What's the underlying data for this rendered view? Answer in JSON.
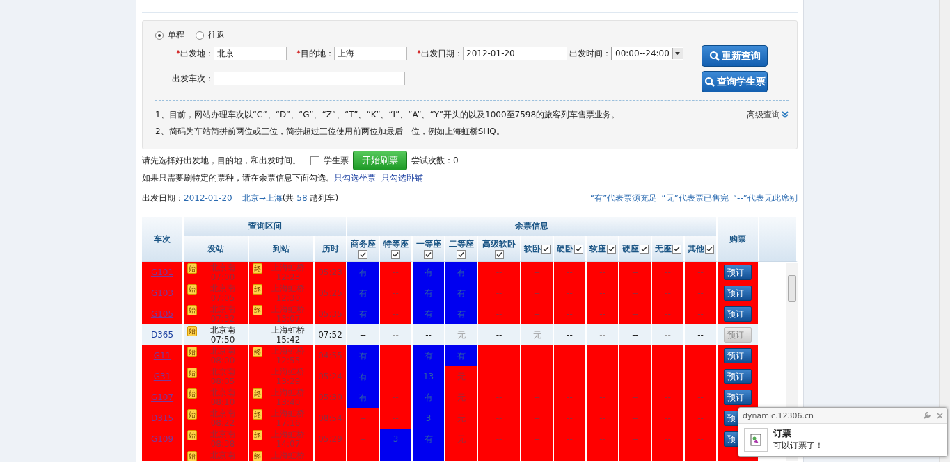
{
  "search": {
    "trip_types": [
      {
        "label": "单程",
        "selected": true
      },
      {
        "label": "往返",
        "selected": false
      }
    ],
    "from": {
      "mark": "*",
      "label": "出发地：",
      "value": "北京"
    },
    "to": {
      "mark": "*",
      "label": "目的地：",
      "value": "上海"
    },
    "date": {
      "mark": "*",
      "label": "出发日期：",
      "value": "2012-01-20"
    },
    "time": {
      "label": "出发时间：",
      "value": "00:00--24:00"
    },
    "train_no": {
      "label": "出发车次："
    },
    "buttons": [
      "重新查询",
      "查询学生票"
    ],
    "notes": [
      "1、目前，网站办理车次以“C”、“D”、“G”、“Z”、“T”、“K”、“L”、“A”、“Y”开头的以及1000至7598的旅客列车售票业务。",
      "2、简码为车站简拼前两位或三位，简拼超过三位使用前两位加最后一位，例如上海虹桥SHQ。"
    ],
    "advanced": "高级查询"
  },
  "refresh": {
    "hint": "请先选择好出发地，目的地，和出发时间。",
    "student": {
      "label": "学生票",
      "checked": false
    },
    "button": "开始刷票",
    "attempts": "尝试次数：0",
    "hint2": "如果只需要刷特定的票种，请在余票信息下面勾选。",
    "links": [
      "只勾选坐票",
      "只勾选卧铺"
    ]
  },
  "summary": {
    "date_label": "出发日期：",
    "date": "2012-01-20",
    "route": "北京→上海",
    "count_prefix": "(共",
    "count": "58",
    "count_suffix": "趟列车)",
    "legend": [
      "“有”代表票源充足",
      "“无”代表票已售完",
      "“--”代表无此席别"
    ]
  },
  "table": {
    "group_headers": [
      "车次",
      "查询区间",
      "余票信息",
      "购票"
    ],
    "route_headers": [
      "发站",
      "到站",
      "历时"
    ],
    "seat_headers": [
      {
        "label": "商务座",
        "checked": true
      },
      {
        "label": "特等座",
        "checked": true
      },
      {
        "label": "一等座",
        "checked": true
      },
      {
        "label": "二等座",
        "checked": true
      },
      {
        "label": "高级软卧",
        "checked": true
      },
      {
        "label": "软卧",
        "checked": true
      },
      {
        "label": "硬卧",
        "checked": true
      },
      {
        "label": "软座",
        "checked": true
      },
      {
        "label": "硬座",
        "checked": true
      },
      {
        "label": "无座",
        "checked": true
      },
      {
        "label": "其他",
        "checked": true
      }
    ],
    "rows": [
      {
        "train": "G101",
        "highlighted": true,
        "from_badge": "始",
        "from": "北京南",
        "dep": "07:00",
        "to_badge": "终",
        "to": "上海虹桥",
        "arr": "12:23",
        "duration": "05:23",
        "seats": [
          {
            "text": "有",
            "available": true
          },
          {
            "text": "--",
            "available": false
          },
          {
            "text": "有",
            "available": true
          },
          {
            "text": "有",
            "available": true
          },
          {
            "text": "--",
            "available": false
          },
          {
            "text": "--",
            "available": false
          },
          {
            "text": "--",
            "available": false
          },
          {
            "text": "--",
            "available": false
          },
          {
            "text": "--",
            "available": false
          },
          {
            "text": "--",
            "available": false
          },
          {
            "text": "--",
            "available": false
          }
        ],
        "button": {
          "label": "预订",
          "disabled": false
        }
      },
      {
        "train": "G103",
        "highlighted": true,
        "from_badge": "始",
        "from": "北京南",
        "dep": "07:05",
        "to_badge": "终",
        "to": "上海虹桥",
        "arr": "12:30",
        "duration": "05:25",
        "seats": [
          {
            "text": "有",
            "available": true
          },
          {
            "text": "--",
            "available": false
          },
          {
            "text": "有",
            "available": true
          },
          {
            "text": "有",
            "available": true
          },
          {
            "text": "--",
            "available": false
          },
          {
            "text": "--",
            "available": false
          },
          {
            "text": "--",
            "available": false
          },
          {
            "text": "--",
            "available": false
          },
          {
            "text": "--",
            "available": false
          },
          {
            "text": "--",
            "available": false
          },
          {
            "text": "--",
            "available": false
          }
        ],
        "button": {
          "label": "预订",
          "disabled": false
        }
      },
      {
        "train": "G105",
        "highlighted": true,
        "from_badge": "始",
        "from": "北京南",
        "dep": "07:32",
        "to_badge": "终",
        "to": "上海虹桥",
        "arr": "13:07",
        "duration": "05:35",
        "seats": [
          {
            "text": "有",
            "available": true
          },
          {
            "text": "--",
            "available": false
          },
          {
            "text": "有",
            "available": true
          },
          {
            "text": "有",
            "available": true
          },
          {
            "text": "--",
            "available": false
          },
          {
            "text": "--",
            "available": false
          },
          {
            "text": "--",
            "available": false
          },
          {
            "text": "--",
            "available": false
          },
          {
            "text": "--",
            "available": false
          },
          {
            "text": "--",
            "available": false
          },
          {
            "text": "--",
            "available": false
          }
        ],
        "button": {
          "label": "预订",
          "disabled": false
        }
      },
      {
        "train": "D365",
        "highlighted": false,
        "from_badge": "始",
        "from": "北京南",
        "dep": "07:50",
        "to": "上海虹桥",
        "arr": "15:42",
        "duration": "07:52",
        "seats": [
          {
            "text": "--",
            "available": false
          },
          {
            "text": "--",
            "available": false
          },
          {
            "text": "--",
            "available": false
          },
          {
            "text": "无",
            "available": false
          },
          {
            "text": "--",
            "available": false
          },
          {
            "text": "无",
            "available": false
          },
          {
            "text": "--",
            "available": false
          },
          {
            "text": "--",
            "available": false
          },
          {
            "text": "--",
            "available": false
          },
          {
            "text": "--",
            "available": false
          },
          {
            "text": "--",
            "available": false
          }
        ],
        "button": {
          "label": "预订",
          "disabled": true
        }
      },
      {
        "train": "G11",
        "highlighted": true,
        "from_badge": "始",
        "from": "北京南",
        "dep": "08:00",
        "to_badge": "终",
        "to": "上海虹桥",
        "arr": "12:55",
        "duration": "04:55",
        "seats": [
          {
            "text": "有",
            "available": true
          },
          {
            "text": "--",
            "available": false
          },
          {
            "text": "有",
            "available": true
          },
          {
            "text": "有",
            "available": true
          },
          {
            "text": "--",
            "available": false
          },
          {
            "text": "--",
            "available": false
          },
          {
            "text": "--",
            "available": false
          },
          {
            "text": "--",
            "available": false
          },
          {
            "text": "--",
            "available": false
          },
          {
            "text": "--",
            "available": false
          },
          {
            "text": "--",
            "available": false
          }
        ],
        "button": {
          "label": "预订",
          "disabled": false
        }
      },
      {
        "train": "G31",
        "highlighted": true,
        "from_badge": "始",
        "from": "北京南",
        "dep": "08:05",
        "to": "上海虹桥",
        "arr": "13:29",
        "duration": "05:24",
        "seats": [
          {
            "text": "有",
            "available": true
          },
          {
            "text": "--",
            "available": false
          },
          {
            "text": "13",
            "available": true
          },
          {
            "text": "无",
            "available": false
          },
          {
            "text": "--",
            "available": false
          },
          {
            "text": "--",
            "available": false
          },
          {
            "text": "--",
            "available": false
          },
          {
            "text": "--",
            "available": false
          },
          {
            "text": "--",
            "available": false
          },
          {
            "text": "--",
            "available": false
          },
          {
            "text": "--",
            "available": false
          }
        ],
        "button": {
          "label": "预订",
          "disabled": false
        }
      },
      {
        "train": "G107",
        "highlighted": true,
        "from_badge": "始",
        "from": "北京南",
        "dep": "08:10",
        "to_badge": "终",
        "to": "上海虹桥",
        "arr": "13:40",
        "duration": "05:30",
        "seats": [
          {
            "text": "有",
            "available": true
          },
          {
            "text": "--",
            "available": false
          },
          {
            "text": "有",
            "available": true
          },
          {
            "text": "无",
            "available": false
          },
          {
            "text": "--",
            "available": false
          },
          {
            "text": "--",
            "available": false
          },
          {
            "text": "--",
            "available": false
          },
          {
            "text": "--",
            "available": false
          },
          {
            "text": "--",
            "available": false
          },
          {
            "text": "--",
            "available": false
          },
          {
            "text": "--",
            "available": false
          }
        ],
        "button": {
          "label": "预订",
          "disabled": false
        }
      },
      {
        "train": "D315",
        "highlighted": true,
        "from_badge": "始",
        "from": "北京南",
        "dep": "08:22",
        "to_badge": "终",
        "to": "上海虹桥",
        "arr": "17:16",
        "duration": "08:54",
        "seats": [
          {
            "text": "--",
            "available": false
          },
          {
            "text": "--",
            "available": false
          },
          {
            "text": "3",
            "available": true
          },
          {
            "text": "无",
            "available": false
          },
          {
            "text": "--",
            "available": false
          },
          {
            "text": "--",
            "available": false
          },
          {
            "text": "--",
            "available": false
          },
          {
            "text": "--",
            "available": false
          },
          {
            "text": "--",
            "available": false
          },
          {
            "text": "--",
            "available": false
          },
          {
            "text": "--",
            "available": false
          }
        ],
        "button": {
          "label": "预",
          "disabled": false
        }
      },
      {
        "train": "G109",
        "highlighted": true,
        "from_badge": "始",
        "from": "北京南",
        "dep": "08:38",
        "to_badge": "终",
        "to": "上海虹桥",
        "arr": "14:07",
        "duration": "05:29",
        "seats": [
          {
            "text": "--",
            "available": false
          },
          {
            "text": "3",
            "available": true
          },
          {
            "text": "有",
            "available": true
          },
          {
            "text": "无",
            "available": false
          },
          {
            "text": "--",
            "available": false
          },
          {
            "text": "--",
            "available": false
          },
          {
            "text": "--",
            "available": false
          },
          {
            "text": "--",
            "available": false
          },
          {
            "text": "--",
            "available": false
          },
          {
            "text": "--",
            "available": false
          },
          {
            "text": "--",
            "available": false
          }
        ],
        "button": {
          "label": "预",
          "disabled": false
        }
      },
      {
        "highlighted": true,
        "from_badge": "始",
        "from": "北京南",
        "to_badge": "终",
        "to": "上海虹桥",
        "seats": [
          {
            "available": false
          },
          {
            "available": true
          },
          {
            "available": true
          },
          {
            "available": false
          },
          {
            "available": false
          },
          {
            "available": false
          },
          {
            "available": false
          },
          {
            "available": false
          },
          {
            "available": false
          },
          {
            "available": false
          },
          {
            "available": false
          }
        ]
      }
    ]
  },
  "notification": {
    "source": "dynamic.12306.cn",
    "title": "订票",
    "message": "可以订票了！"
  }
}
